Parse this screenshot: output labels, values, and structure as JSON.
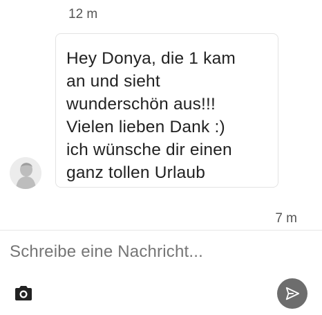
{
  "messages": [
    {
      "timestamp": "12 m",
      "text": "Hey Donya, die 1 kam\nan und sieht\nwunderschön aus!!!\nVielen lieben Dank :)\nich wünsche dir einen\nganz tollen Urlaub",
      "avatar_icon": "person-silhouette-icon"
    }
  ],
  "last_timestamp": "7 m",
  "composer": {
    "placeholder": "Schreibe eine Nachricht...",
    "value": "",
    "camera_icon": "camera-icon",
    "send_icon": "send-icon"
  },
  "colors": {
    "send_button": "#6d6d6d",
    "bubble_border": "#e3e3e3",
    "timestamp": "#555555"
  }
}
